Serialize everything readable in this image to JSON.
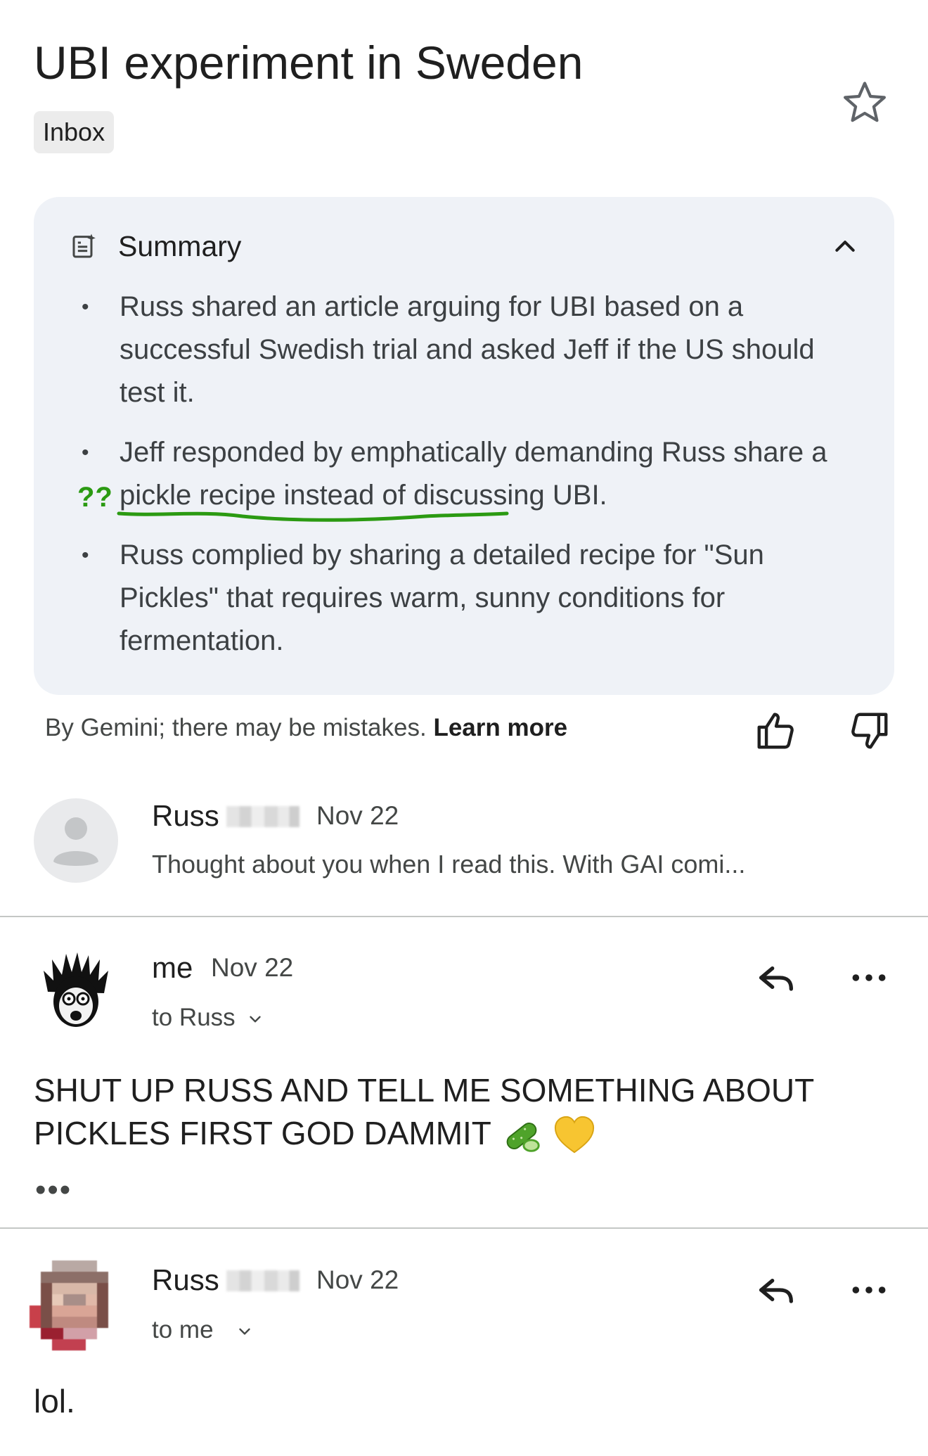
{
  "thread": {
    "subject": "UBI experiment in Sweden",
    "label": "Inbox",
    "star_icon": "star-outline-icon"
  },
  "summary": {
    "title": "Summary",
    "items": [
      "Russ shared an article arguing for UBI based on a successful Swedish trial and asked Jeff if the US should test it.",
      "Jeff responded by emphatically demanding Russ share a pickle recipe instead of discussing UBI.",
      "Russ complied by sharing a detailed recipe for \"Sun Pickles\" that requires warm, sunny conditions for fermentation."
    ],
    "annotation_mark": "??",
    "annotation_color": "#2b9a12"
  },
  "disclaimer": {
    "text": "By Gemini; there may be mistakes.",
    "link": "Learn more"
  },
  "messages": [
    {
      "sender": "Russ",
      "date": "Nov 22",
      "snippet": "Thought about you when I read this. With GAI comi..."
    },
    {
      "sender": "me",
      "date": "Nov 22",
      "recipient": "to Russ",
      "body": "SHUT UP RUSS AND TELL ME SOMETHING ABOUT PICKLES FIRST GOD DAMMIT",
      "emoji": [
        "cucumber",
        "yellow-heart"
      ],
      "trimmed_indicator": "•••"
    },
    {
      "sender": "Russ",
      "date": "Nov 22",
      "recipient": "to me",
      "body": "lol."
    }
  ],
  "colors": {
    "summary_bg": "#eff2f7",
    "label_bg": "#ececec",
    "text_primary": "#1f1f1f",
    "text_secondary": "#444746"
  }
}
